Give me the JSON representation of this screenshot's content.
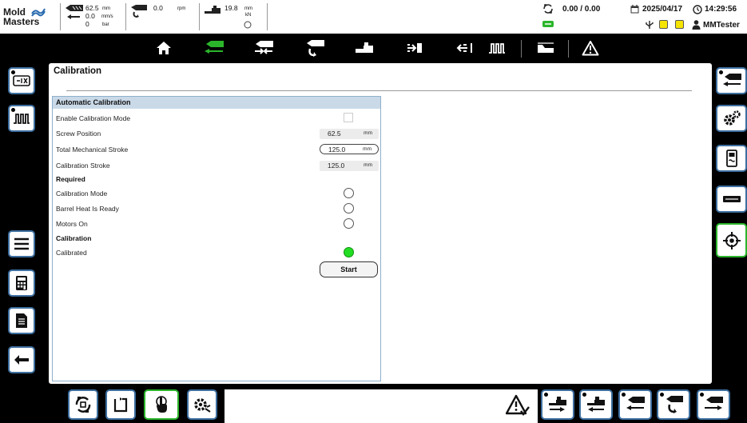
{
  "status": {
    "logo_line1": "Mold",
    "logo_line2": "Masters",
    "injection": {
      "position": "62.5",
      "position_unit": "mm",
      "speed": "0.0",
      "speed_unit": "mm/s",
      "pressure": "0",
      "pressure_unit": "bar"
    },
    "screw": {
      "rpm": "0.0",
      "rpm_unit": "rpm"
    },
    "clamp": {
      "value": "19.8",
      "value_unit": "mm",
      "force_unit": "kN"
    },
    "cycle": "0.00 / 0.00",
    "date": "2025/04/17",
    "time": "14:29:56",
    "user": "MMTester"
  },
  "nav": {
    "items": [
      "home-icon",
      "injection-icon",
      "clamp-icon",
      "screw-icon",
      "ejector-icon",
      "core-in-icon",
      "core-out-icon",
      "heater-icon",
      "profile-icon",
      "alarm-icon"
    ]
  },
  "page": {
    "title": "Calibration",
    "section_title": "Automatic Calibration",
    "rows": {
      "enable_mode": "Enable Calibration Mode",
      "screw_position": "Screw Position",
      "screw_position_value": "62.5",
      "screw_position_unit": "mm",
      "total_stroke": "Total Mechanical Stroke",
      "total_stroke_value": "125.0",
      "total_stroke_unit": "mm",
      "calib_stroke": "Calibration Stroke",
      "calib_stroke_value": "125.0",
      "calib_stroke_unit": "mm",
      "required_header": "Required",
      "calib_mode": "Calibration Mode",
      "barrel_heat": "Barrel Heat Is Ready",
      "motors_on": "Motors On",
      "calibration_header": "Calibration",
      "calibrated": "Calibrated"
    },
    "start_label": "Start"
  },
  "colors": {
    "accent_blue": "#3d6fa0",
    "active_green": "#2bb52b",
    "led_green": "#22dd22",
    "header_blue": "#c9d9e8"
  }
}
